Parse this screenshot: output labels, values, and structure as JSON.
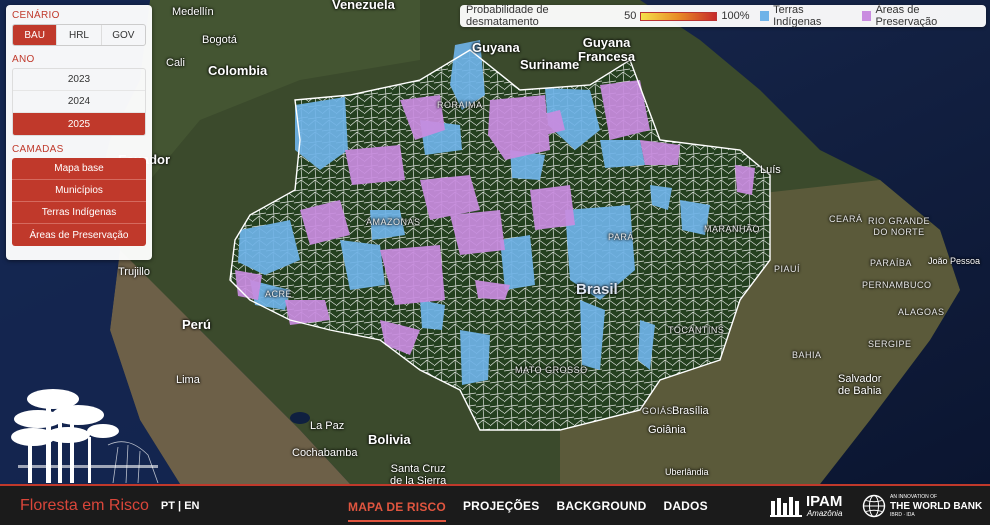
{
  "legend": {
    "probability_label": "Probabilidade de desmatamento",
    "min": "50",
    "max": "100%",
    "indigenous_label": "Terras Indígenas",
    "preservation_label": "Áreas de Preservação",
    "indigenous_color": "#6fb3e8",
    "preservation_color": "#c98ce0",
    "gradient_colors": [
      "#f5e04a",
      "#e88b26",
      "#c62a2a"
    ]
  },
  "panel": {
    "scenario_title": "CENÁRIO",
    "scenarios": [
      "BAU",
      "HRL",
      "GOV"
    ],
    "active_scenario": "BAU",
    "year_title": "ANO",
    "years": [
      "2023",
      "2024",
      "2025"
    ],
    "active_year": "2025",
    "layers_title": "CAMADAS",
    "layers": [
      "Mapa base",
      "Municípios",
      "Terras Indígenas",
      "Áreas de Preservação"
    ],
    "accent_color": "#c0392b"
  },
  "map_labels": {
    "medellin": "Medellín",
    "venezuela": "Venezuela",
    "guyana": "Guyana",
    "guiana_francesa": "Guyana\nFrancesa",
    "suriname": "Suriname",
    "bogota": "Bogotá",
    "cali": "Cali",
    "colombia": "Colombia",
    "ecuador": "Ecuador",
    "trujillo": "Trujillo",
    "peru": "Perú",
    "lima": "Lima",
    "la_paz": "La Paz",
    "bolivia": "Bolivia",
    "cochabamba": "Cochabamba",
    "santa_cruz": "Santa Cruz\nde la Sierra",
    "roraima": "RORAIMA",
    "amazonas": "AMAZONAS",
    "acre": "ACRE",
    "brasil": "Brasil",
    "para": "PARÁ",
    "maranhao": "MARANHÃO",
    "tocantins": "TOCANTINS",
    "mato_grosso": "MATO GROSSO",
    "goias": "GOIÁS",
    "brasilia": "Brasília",
    "goiania": "Goiânia",
    "uberlandia": "Uberlândia",
    "sao_luis": "Luís",
    "ceara": "CEARÁ",
    "rio_grande_do_norte": "RIO GRANDE\nDO NORTE",
    "piaui": "PIAUÍ",
    "paraiba": "PARAÍBA",
    "joao_pessoa": "João Pessoa",
    "pernambuco": "PERNAMBUCO",
    "alagoas": "ALAGOAS",
    "sergipe": "SERGIPE",
    "bahia": "BAHIA",
    "salvador": "Salvador\nde Bahia"
  },
  "footer": {
    "site_title": "Floresta em Risco",
    "lang_pt": "PT",
    "lang_sep": "|",
    "lang_en": "EN",
    "nav": [
      "MAPA DE RISCO",
      "PROJEÇÕES",
      "BACKGROUND",
      "DADOS"
    ],
    "active_nav": "MAPA DE RISCO",
    "ipam_name": "IPAM",
    "ipam_sub": "Amazônia",
    "wb_line1": "AN INNOVATION OF",
    "wb_line2": "THE WORLD BANK",
    "wb_line3": "IBRD · IDA"
  }
}
